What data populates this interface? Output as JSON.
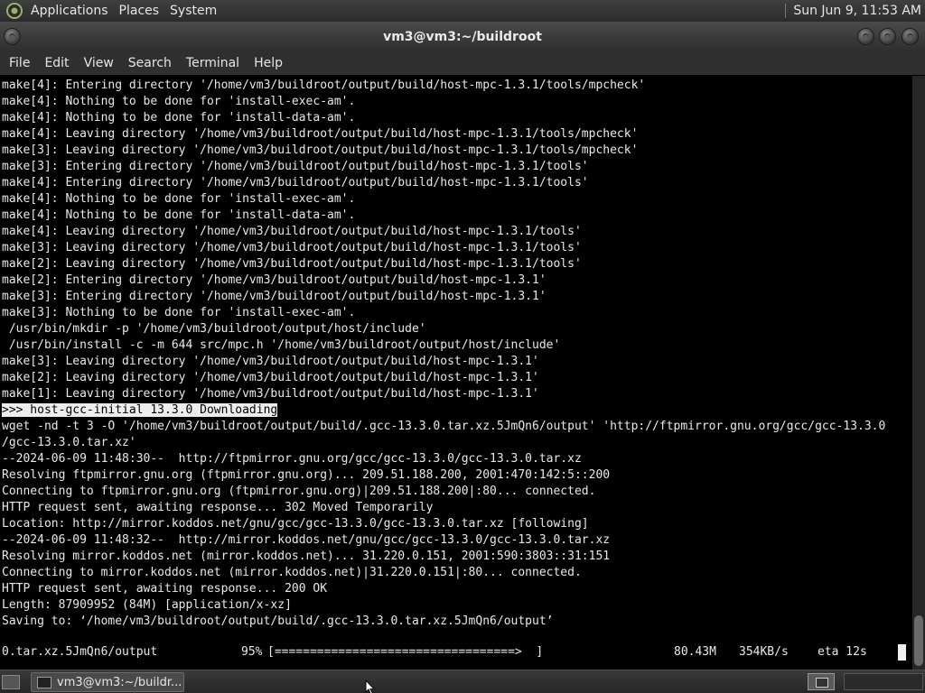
{
  "top_panel": {
    "menus": [
      "Applications",
      "Places",
      "System"
    ],
    "clock": "Sun Jun  9, 11:53 AM"
  },
  "window": {
    "title": "vm3@vm3:~/buildroot"
  },
  "menubar": {
    "items": [
      "File",
      "Edit",
      "View",
      "Search",
      "Terminal",
      "Help"
    ]
  },
  "terminal": {
    "lines": [
      "make[4]: Entering directory '/home/vm3/buildroot/output/build/host-mpc-1.3.1/tools/mpcheck'",
      "make[4]: Nothing to be done for 'install-exec-am'.",
      "make[4]: Nothing to be done for 'install-data-am'.",
      "make[4]: Leaving directory '/home/vm3/buildroot/output/build/host-mpc-1.3.1/tools/mpcheck'",
      "make[3]: Leaving directory '/home/vm3/buildroot/output/build/host-mpc-1.3.1/tools/mpcheck'",
      "make[3]: Entering directory '/home/vm3/buildroot/output/build/host-mpc-1.3.1/tools'",
      "make[4]: Entering directory '/home/vm3/buildroot/output/build/host-mpc-1.3.1/tools'",
      "make[4]: Nothing to be done for 'install-exec-am'.",
      "make[4]: Nothing to be done for 'install-data-am'.",
      "make[4]: Leaving directory '/home/vm3/buildroot/output/build/host-mpc-1.3.1/tools'",
      "make[3]: Leaving directory '/home/vm3/buildroot/output/build/host-mpc-1.3.1/tools'",
      "make[2]: Leaving directory '/home/vm3/buildroot/output/build/host-mpc-1.3.1/tools'",
      "make[2]: Entering directory '/home/vm3/buildroot/output/build/host-mpc-1.3.1'",
      "make[3]: Entering directory '/home/vm3/buildroot/output/build/host-mpc-1.3.1'",
      "make[3]: Nothing to be done for 'install-exec-am'.",
      " /usr/bin/mkdir -p '/home/vm3/buildroot/output/host/include'",
      " /usr/bin/install -c -m 644 src/mpc.h '/home/vm3/buildroot/output/host/include'",
      "make[3]: Leaving directory '/home/vm3/buildroot/output/build/host-mpc-1.3.1'",
      "make[2]: Leaving directory '/home/vm3/buildroot/output/build/host-mpc-1.3.1'",
      "make[1]: Leaving directory '/home/vm3/buildroot/output/build/host-mpc-1.3.1'",
      ">>> host-gcc-initial 13.3.0 Downloading",
      "wget -nd -t 3 -O '/home/vm3/buildroot/output/build/.gcc-13.3.0.tar.xz.5JmQn6/output' 'http://ftpmirror.gnu.org/gcc/gcc-13.3.0",
      "/gcc-13.3.0.tar.xz'",
      "--2024-06-09 11:48:30--  http://ftpmirror.gnu.org/gcc/gcc-13.3.0/gcc-13.3.0.tar.xz",
      "Resolving ftpmirror.gnu.org (ftpmirror.gnu.org)... 209.51.188.200, 2001:470:142:5::200",
      "Connecting to ftpmirror.gnu.org (ftpmirror.gnu.org)|209.51.188.200|:80... connected.",
      "HTTP request sent, awaiting response... 302 Moved Temporarily",
      "Location: http://mirror.koddos.net/gnu/gcc/gcc-13.3.0/gcc-13.3.0.tar.xz [following]",
      "--2024-06-09 11:48:32--  http://mirror.koddos.net/gnu/gcc/gcc-13.3.0/gcc-13.3.0.tar.xz",
      "Resolving mirror.koddos.net (mirror.koddos.net)... 31.220.0.151, 2001:590:3803::31:151",
      "Connecting to mirror.koddos.net (mirror.koddos.net)|31.220.0.151|:80... connected.",
      "HTTP request sent, awaiting response... 200 OK",
      "Length: 87909952 (84M) [application/x-xz]",
      "Saving to: ‘/home/vm3/buildroot/output/build/.gcc-13.3.0.tar.xz.5JmQn6/output’"
    ],
    "highlighted_line": 20,
    "progress": {
      "filename": "0.tar.xz.5JmQn6/output",
      "percent": "95%",
      "bar": "[==================================>  ]",
      "bar_fraction": 0.95,
      "size": "80.43M",
      "speed": "354KB/s",
      "eta": "eta 12s"
    }
  },
  "taskbar": {
    "task_label": "vm3@vm3:~/buildr..."
  }
}
